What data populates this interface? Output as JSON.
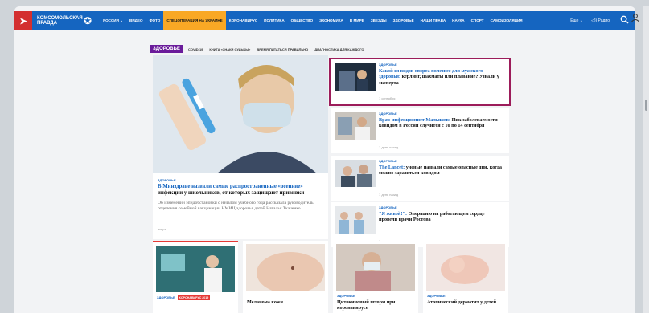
{
  "brand": {
    "logo_text": "Комсомольская правда",
    "accent": "#1565c0",
    "highlight": "#f9a825",
    "section_color": "#6a1b9a",
    "active_outline": "#9c1c5a"
  },
  "nav": {
    "items": [
      "Россия",
      "Видео",
      "Фото",
      "Спецоперация на Украине",
      "Коронавирус",
      "Политика",
      "Общество",
      "Экономика",
      "В мире",
      "Звезды",
      "Здоровье",
      "Наши права",
      "Наука",
      "Спорт",
      "Самоизоляция"
    ],
    "region": "Еще",
    "radio": "Радио"
  },
  "section": {
    "tag": "Здоровье",
    "subtags": [
      "COVID-19",
      "Книга «Знаки судьбы»",
      "Время питаться правильно",
      "Диагностика для каждого"
    ]
  },
  "main": {
    "category": "Здоровье",
    "title_blue": "В Минздраве назвали самые распространенные «осенние»",
    "title_rest": " инфекции у школьников, от которых защищают прививки",
    "lead": "Об изменении эпидобстановки с началом учебного года рассказала руководитель отделения семейной вакцинации НМИЦ здоровья детей Наталья Ткаченко",
    "time": "вчера"
  },
  "side": [
    {
      "category": "Здоровье",
      "title_blue": "Какой из видов спорта полезнее для мужского здоровья:",
      "title_rest": " керлинг, шахматы или плавание? Узнали у эксперта",
      "time": "1 сентября"
    },
    {
      "category": "Здоровье",
      "title_blue": "Врач-инфекционист Малышев:",
      "title_rest": " Пик заболеваемости ковидом в России случится с 10 по 14 сентября",
      "time": "1 день назад"
    },
    {
      "category": "Здоровье",
      "title_blue": "The Lancet:",
      "title_rest": " ученые назвали самые опасные дни, когда можно заразиться ковидом",
      "time": "1 день назад"
    },
    {
      "category": "Здоровье",
      "title_blue": "\"Я живой!\":",
      "title_rest": " Операцию на работающем сердце провели врачи Ростова",
      "time": "1 день назад"
    }
  ],
  "bottom": [
    {
      "category": "Здоровье",
      "badge": "Коронавирус 2019",
      "title": ""
    },
    {
      "category": "",
      "badge": "",
      "title": "Меланома кожи"
    },
    {
      "category": "Здоровье",
      "badge": "",
      "title": "Цитокиновый шторм при коронавирусе"
    },
    {
      "category": "Здоровье",
      "badge": "",
      "title": "Атопический дерматит у детей"
    }
  ]
}
